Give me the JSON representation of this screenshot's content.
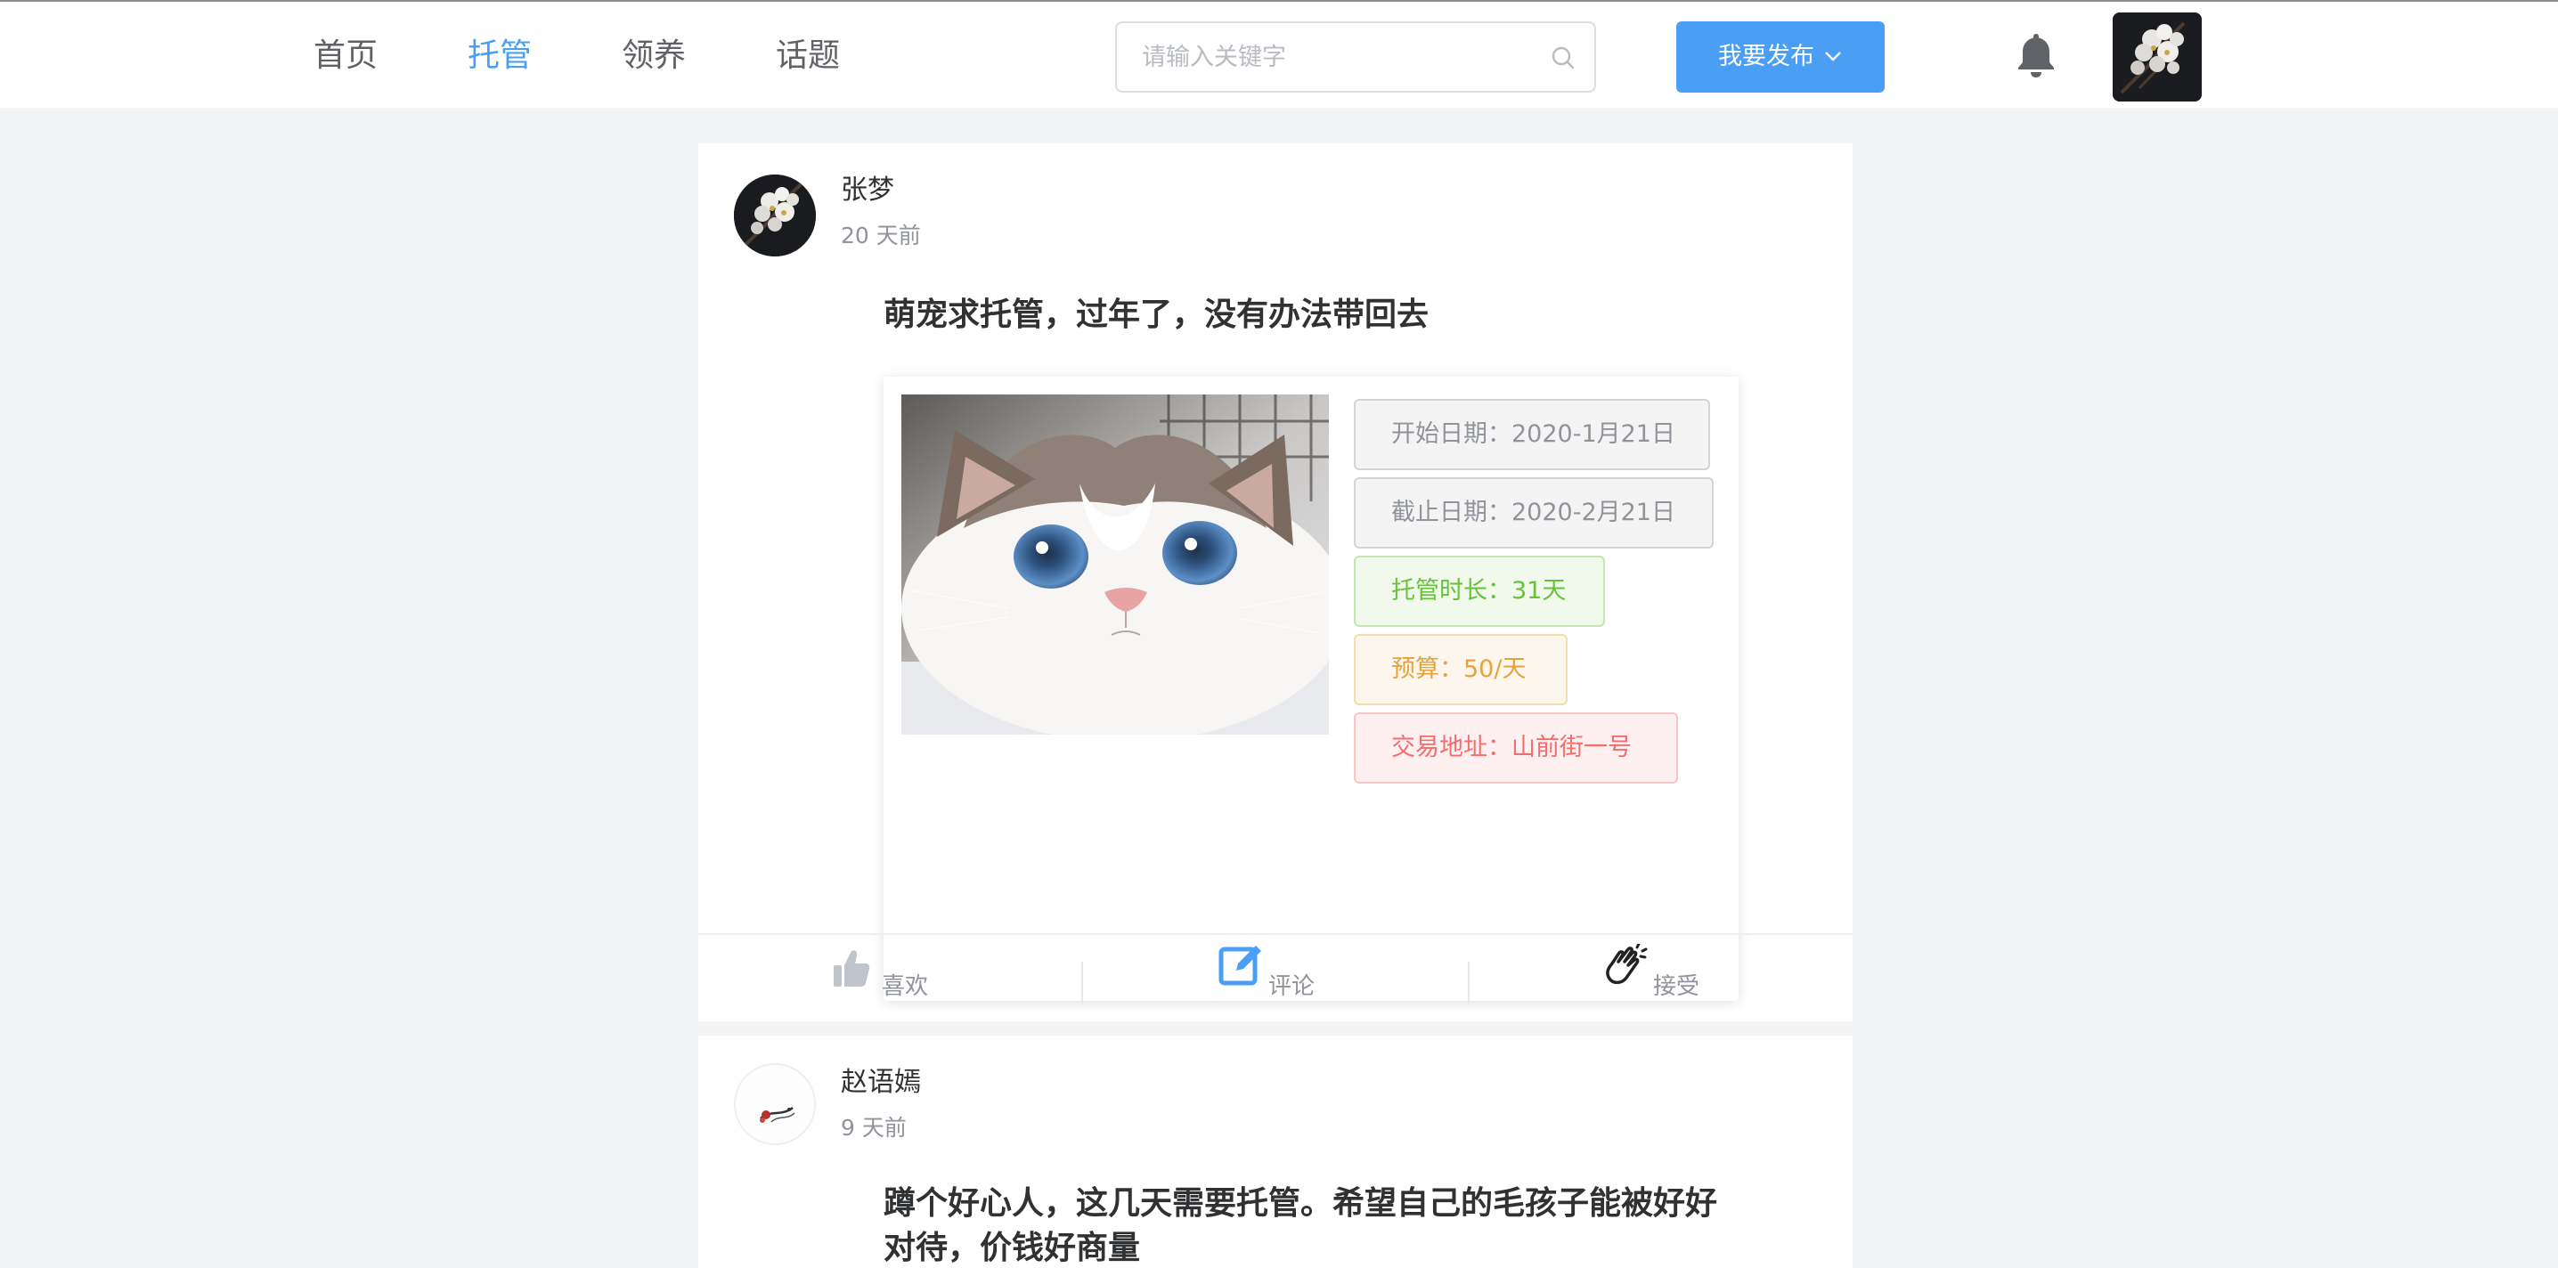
{
  "nav": {
    "items": [
      {
        "label": "首页"
      },
      {
        "label": "托管"
      },
      {
        "label": "领养"
      },
      {
        "label": "话题"
      }
    ],
    "active": "托管"
  },
  "search": {
    "placeholder": "请输入关键字",
    "value": ""
  },
  "publish": {
    "label": "我要发布"
  },
  "icons": {
    "search": "search-icon",
    "dropdown": "chevron-down-icon",
    "notification": "bell-icon",
    "like": "thumbs-up-icon",
    "comment": "edit-icon",
    "accept": "clapping-hands-icon"
  },
  "colors": {
    "accent": "#4a9ef4",
    "info_tag": "#909399",
    "success_tag": "#67c23a",
    "warning_tag": "#e6a23c",
    "danger_tag": "#f56c6c"
  },
  "posts": [
    {
      "author": "张梦",
      "time": "20 天前",
      "title": "萌宠求托管，过年了，没有办法带回去",
      "tags": {
        "start": "开始日期：2020-1月21日",
        "end": "截止日期：2020-2月21日",
        "duration": "托管时长：31天",
        "budget": "预算：50/天",
        "address": "交易地址：山前街一号"
      },
      "actions": {
        "like": "喜欢",
        "comment": "评论",
        "accept": "接受"
      }
    },
    {
      "author": "赵语嫣",
      "time": "9 天前",
      "title": "蹲个好心人，这几天需要托管。希望自己的毛孩子能被好好对待，价钱好商量"
    }
  ]
}
